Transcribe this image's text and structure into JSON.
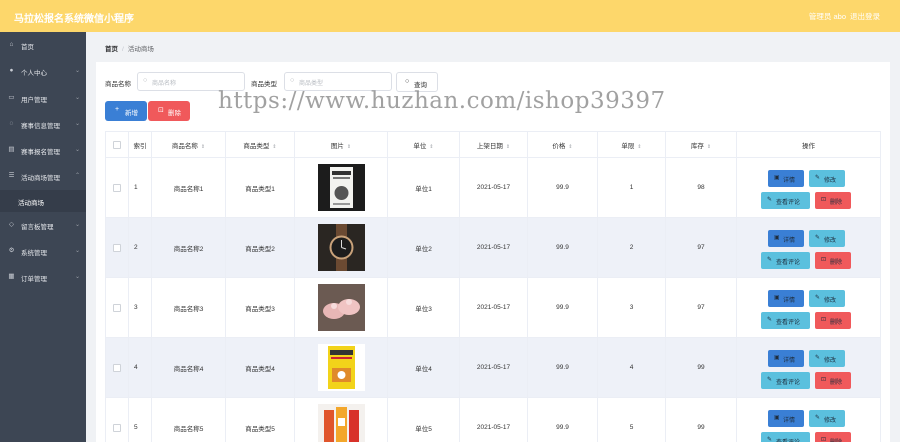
{
  "header": {
    "title": "马拉松报名系统微信小程序",
    "admin_label": "管理员 abo",
    "logout_label": "退出登录"
  },
  "sidebar": {
    "items": [
      {
        "label": "首页",
        "icon": "home-icon",
        "has_arrow": false
      },
      {
        "label": "个人中心",
        "icon": "user-icon",
        "has_arrow": true
      },
      {
        "label": "用户管理",
        "icon": "users-icon",
        "has_arrow": true
      },
      {
        "label": "赛事信息管理",
        "icon": "info-icon",
        "has_arrow": true
      },
      {
        "label": "赛事报名管理",
        "icon": "register-icon",
        "has_arrow": true
      },
      {
        "label": "活动商场管理",
        "icon": "shop-icon",
        "has_arrow": true,
        "expanded": true,
        "children": [
          {
            "label": "活动商场"
          }
        ]
      },
      {
        "label": "留言板管理",
        "icon": "message-icon",
        "has_arrow": true
      },
      {
        "label": "系统管理",
        "icon": "settings-icon",
        "has_arrow": true
      },
      {
        "label": "订单管理",
        "icon": "order-icon",
        "has_arrow": true
      }
    ]
  },
  "breadcrumb": {
    "home": "首页",
    "current": "活动商场"
  },
  "search": {
    "name_label": "商品名称",
    "name_placeholder": "商品名称",
    "type_label": "商品类型",
    "type_placeholder": "商品类型",
    "button_label": "查询"
  },
  "toolbar": {
    "add_label": "新增",
    "delete_label": "删除"
  },
  "table": {
    "columns": [
      "索引",
      "商品名称",
      "商品类型",
      "图片",
      "单位",
      "上架日期",
      "价格",
      "单限",
      "库存",
      "操作"
    ],
    "rows": [
      {
        "index": "1",
        "name": "商品名称1",
        "type": "商品类型1",
        "image": "book-cover-image",
        "unit": "单位1",
        "date": "2021-05-17",
        "price": "99.9",
        "limit": "1",
        "stock": "98"
      },
      {
        "index": "2",
        "name": "商品名称2",
        "type": "商品类型2",
        "image": "wristwatch-image",
        "unit": "单位2",
        "date": "2021-05-17",
        "price": "99.9",
        "limit": "2",
        "stock": "97"
      },
      {
        "index": "3",
        "name": "商品名称3",
        "type": "商品类型3",
        "image": "pink-shoes-image",
        "unit": "单位3",
        "date": "2021-05-17",
        "price": "99.9",
        "limit": "3",
        "stock": "97"
      },
      {
        "index": "4",
        "name": "商品名称4",
        "type": "商品类型4",
        "image": "yellow-book-image",
        "unit": "单位4",
        "date": "2021-05-17",
        "price": "99.9",
        "limit": "4",
        "stock": "99"
      },
      {
        "index": "5",
        "name": "商品名称5",
        "type": "商品类型5",
        "image": "drink-cartons-image",
        "unit": "单位5",
        "date": "2021-05-17",
        "price": "99.9",
        "limit": "5",
        "stock": "99"
      }
    ],
    "actions": {
      "detail": "详情",
      "edit": "修改",
      "review": "查看评论",
      "delete": "删除"
    }
  },
  "watermark": "https://www.huzhan.com/ishop39397",
  "colors": {
    "header": "#fdd76b",
    "sidebar": "#3d4654",
    "primary": "#3a7fd5",
    "info": "#5bc0de",
    "danger": "#f0595b"
  }
}
